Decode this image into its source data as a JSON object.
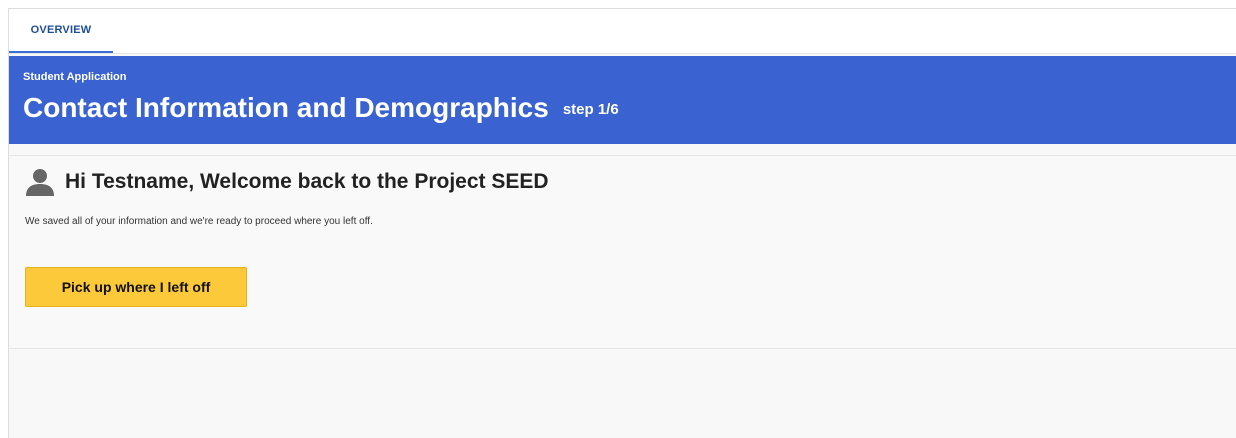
{
  "tabs": [
    {
      "label": "OVERVIEW",
      "active": true
    }
  ],
  "header": {
    "subtitle": "Student Application",
    "title": "Contact Information and Demographics",
    "step": "step 1/6",
    "background_color": "#3a63d1"
  },
  "welcome": {
    "icon": "user-icon",
    "greeting": "Hi Testname, Welcome back to the Project SEED",
    "message": "We saved all of your information and we're ready to proceed where you left off.",
    "button_label": "Pick up where I left off",
    "button_color": "#fcc93a"
  }
}
